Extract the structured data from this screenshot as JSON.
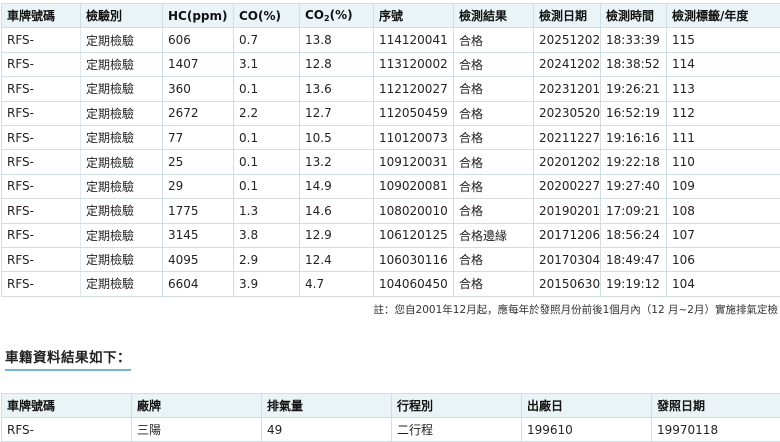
{
  "inspection": {
    "headers": {
      "plate": "車牌號碼",
      "type": "檢驗別",
      "hc": "HC(ppm)",
      "co": "CO(%)",
      "co2_prefix": "CO",
      "co2_sub": "2",
      "co2_suffix": "(%)",
      "serial": "序號",
      "result": "檢測結果",
      "date": "檢測日期",
      "time": "檢測時間",
      "label": "檢測標籤/年度"
    },
    "rows": [
      {
        "plate": "RFS-",
        "type": "定期檢驗",
        "hc": "606",
        "co": "0.7",
        "co2": "13.8",
        "serial": "114120041",
        "result": "合格",
        "date": "20251202",
        "time": "18:33:39",
        "label": "115"
      },
      {
        "plate": "RFS-",
        "type": "定期檢驗",
        "hc": "1407",
        "co": "3.1",
        "co2": "12.8",
        "serial": "113120002",
        "result": "合格",
        "date": "20241202",
        "time": "18:38:52",
        "label": "114"
      },
      {
        "plate": "RFS-",
        "type": "定期檢驗",
        "hc": "360",
        "co": "0.1",
        "co2": "13.6",
        "serial": "112120027",
        "result": "合格",
        "date": "20231201",
        "time": "19:26:21",
        "label": "113"
      },
      {
        "plate": "RFS-",
        "type": "定期檢驗",
        "hc": "2672",
        "co": "2.2",
        "co2": "12.7",
        "serial": "112050459",
        "result": "合格",
        "date": "20230520",
        "time": "16:52:19",
        "label": "112"
      },
      {
        "plate": "RFS-",
        "type": "定期檢驗",
        "hc": "77",
        "co": "0.1",
        "co2": "10.5",
        "serial": "110120073",
        "result": "合格",
        "date": "20211227",
        "time": "19:16:16",
        "label": "111"
      },
      {
        "plate": "RFS-",
        "type": "定期檢驗",
        "hc": "25",
        "co": "0.1",
        "co2": "13.2",
        "serial": "109120031",
        "result": "合格",
        "date": "20201202",
        "time": "19:22:18",
        "label": "110"
      },
      {
        "plate": "RFS-",
        "type": "定期檢驗",
        "hc": "29",
        "co": "0.1",
        "co2": "14.9",
        "serial": "109020081",
        "result": "合格",
        "date": "20200227",
        "time": "19:27:40",
        "label": "109"
      },
      {
        "plate": "RFS-",
        "type": "定期檢驗",
        "hc": "1775",
        "co": "1.3",
        "co2": "14.6",
        "serial": "108020010",
        "result": "合格",
        "date": "20190201",
        "time": "17:09:21",
        "label": "108"
      },
      {
        "plate": "RFS-",
        "type": "定期檢驗",
        "hc": "3145",
        "co": "3.8",
        "co2": "12.9",
        "serial": "106120125",
        "result": "合格邊緣",
        "date": "20171206",
        "time": "18:56:24",
        "label": "107"
      },
      {
        "plate": "RFS-",
        "type": "定期檢驗",
        "hc": "4095",
        "co": "2.9",
        "co2": "12.4",
        "serial": "106030116",
        "result": "合格",
        "date": "20170304",
        "time": "18:49:47",
        "label": "106"
      },
      {
        "plate": "RFS-",
        "type": "定期檢驗",
        "hc": "6604",
        "co": "3.9",
        "co2": "4.7",
        "serial": "104060450",
        "result": "合格",
        "date": "20150630",
        "time": "19:19:12",
        "label": "104"
      }
    ],
    "note": "註：您自2001年12月起，應每年於發照月份前後1個月內（12 月~2月）實施排氣定檢"
  },
  "vehicle": {
    "title": "車籍資料結果如下：",
    "headers": {
      "plate": "車牌號碼",
      "brand": "廠牌",
      "displacement": "排氣量",
      "stroke": "行程別",
      "mfg": "出廠日",
      "issue": "發照日期"
    },
    "row": {
      "plate": "RFS-",
      "brand": "三陽",
      "displacement": "49",
      "stroke": "二行程",
      "mfg": "199610",
      "issue": "19970118"
    }
  },
  "colors": {
    "header_bg": "#eaf3f6",
    "border": "#cfdde5",
    "title_underline": "#6fb7cf"
  }
}
